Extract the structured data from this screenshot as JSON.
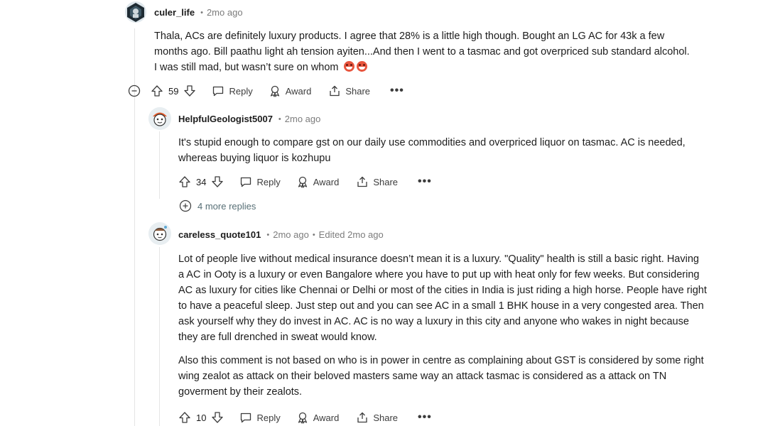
{
  "comments": [
    {
      "username": "culer_life",
      "time": "2mo ago",
      "body": "Thala, ACs are definitely luxury products. I agree that 28% is a little high though. Bought an LG AC for 43k a few months ago. Bill paathu light ah tension ayiten...And then I went to a tasmac and got overpriced sub standard alcohol. I was still mad, but wasn’t sure on whom",
      "votes": "59",
      "reply_label": "Reply",
      "award_label": "Award",
      "share_label": "Share",
      "more_label": "•••"
    },
    {
      "username": "HelpfulGeologist5007",
      "time": "2mo ago",
      "body": "It's stupid enough to compare gst on our daily use commodities and overpriced liquor on tasmac. AC is needed, whereas buying liquor is kozhupu",
      "votes": "34",
      "reply_label": "Reply",
      "award_label": "Award",
      "share_label": "Share",
      "more_label": "•••",
      "more_replies": "4 more replies"
    },
    {
      "username": "careless_quote101",
      "time": "2mo ago",
      "edited": "Edited 2mo ago",
      "body_p1": "Lot of people live without medical insurance doesn’t mean it is a luxury. \"Quality\" health is still a basic right. Having a AC in Ooty is a luxury or even Bangalore where you have to put up with heat only for few weeks. But considering AC as luxury for cities like Chennai or Delhi or most of the cities in India is just riding a high horse. People have right to have a peaceful sleep. Just step out and you can see AC in a small 1 BHK house in a very congested area. Then ask yourself why they do invest in AC. AC is no way a luxury in this city and anyone who wakes in night because they are full drenched in sweat would know.",
      "body_p2": "Also this comment is not based on who is in power in centre as complaining about GST is considered by some right wing zealot as attack on their beloved masters same way an attack tasmac is considered as a attack on TN goverment by their zealots.",
      "votes": "10",
      "reply_label": "Reply",
      "award_label": "Award",
      "share_label": "Share",
      "more_label": "•••"
    }
  ],
  "meta_separator": "•",
  "colors": {
    "text": "#1c1c1c",
    "muted": "#7c7c7c",
    "thread": "#e5e5e5"
  }
}
